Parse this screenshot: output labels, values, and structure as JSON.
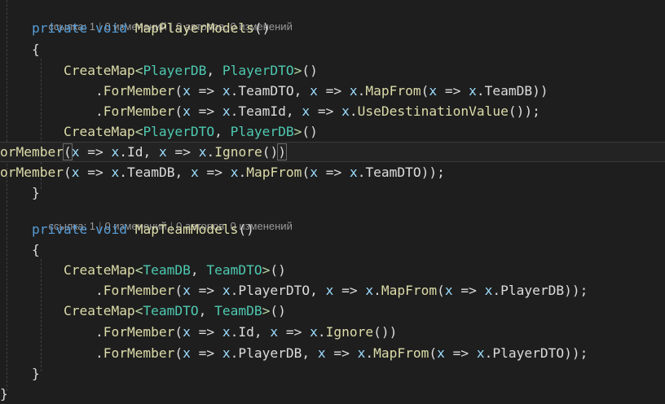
{
  "codelens": [
    {
      "refs": "ссылка: 1",
      "changes": "0 изменений",
      "authors": "0 авторов, 0 изменений"
    },
    {
      "refs": "ссылка: 1",
      "changes": "0 изменений",
      "authors": "0 авторов, 0 изменений"
    }
  ],
  "code_lines": [
    "    private void MapPlayerModels()",
    "    {",
    "        CreateMap<PlayerDB, PlayerDTO>()",
    "            .ForMember(x => x.TeamDTO, x => x.MapFrom(x => x.TeamDB))",
    "            .ForMember(x => x.TeamId, x => x.UseDestinationValue());",
    "        CreateMap<PlayerDTO, PlayerDB>()",
    "orMember(x => x.Id, x => x.Ignore())",
    "orMember(x => x.TeamDB, x => x.MapFrom(x => x.TeamDTO));",
    "    }",
    "    private void MapTeamModels()",
    "    {",
    "        CreateMap<TeamDB, TeamDTO>()",
    "            .ForMember(x => x.PlayerDTO, x => x.MapFrom(x => x.PlayerDB));",
    "        CreateMap<TeamDTO, TeamDB>()",
    "            .ForMember(x => x.Id, x => x.Ignore())",
    "            .ForMember(x => x.PlayerDB, x => x.MapFrom(x => x.PlayerDTO));",
    "    }",
    "}"
  ],
  "colors": {
    "background": "#1e1e1e",
    "keyword": "#569cd6",
    "type": "#4ec9b0",
    "method": "#dcdcaa",
    "parameter": "#9cdcfe",
    "codelens": "#999999"
  }
}
